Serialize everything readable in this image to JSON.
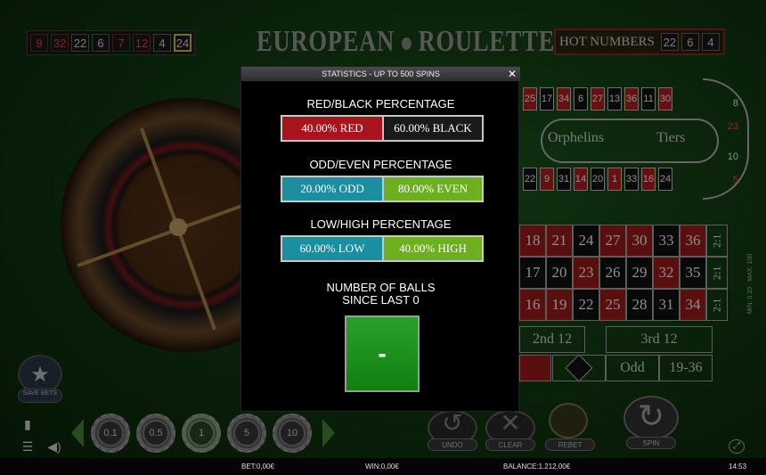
{
  "topbar": {
    "recent_numbers": [
      {
        "n": "9",
        "red": true
      },
      {
        "n": "32",
        "red": true
      },
      {
        "n": "22",
        "red": false
      },
      {
        "n": "6",
        "red": false
      },
      {
        "n": "7",
        "red": true
      },
      {
        "n": "12",
        "red": true
      },
      {
        "n": "4",
        "red": false
      },
      {
        "n": "24",
        "red": false,
        "highlight": true
      }
    ],
    "title_left": "EUROPEAN",
    "title_right": "ROULETTE",
    "hot_label": "HOT NUMBERS",
    "hot_numbers": [
      "22",
      "6",
      "4"
    ]
  },
  "racetrack": {
    "top_row": [
      {
        "n": "25",
        "red": true
      },
      {
        "n": "17",
        "red": false
      },
      {
        "n": "34",
        "red": true
      },
      {
        "n": "6",
        "red": false
      },
      {
        "n": "27",
        "red": true
      },
      {
        "n": "13",
        "red": false
      },
      {
        "n": "36",
        "red": true
      },
      {
        "n": "11",
        "red": false
      },
      {
        "n": "30",
        "red": true
      }
    ],
    "bottom_row": [
      {
        "n": "22",
        "red": false
      },
      {
        "n": "9",
        "red": true
      },
      {
        "n": "31",
        "red": false
      },
      {
        "n": "14",
        "red": true
      },
      {
        "n": "20",
        "red": false
      },
      {
        "n": "1",
        "red": true
      },
      {
        "n": "33",
        "red": false
      },
      {
        "n": "16",
        "red": true
      },
      {
        "n": "24",
        "red": false
      }
    ],
    "end_numbers": [
      {
        "n": "8",
        "red": false
      },
      {
        "n": "23",
        "red": true
      },
      {
        "n": "10",
        "red": false
      },
      {
        "n": "5",
        "red": true
      }
    ],
    "orphelins": "Orphelins",
    "tiers": "Tiers"
  },
  "grid": {
    "rows": [
      [
        {
          "n": "18",
          "red": true
        },
        {
          "n": "21",
          "red": true
        },
        {
          "n": "24",
          "red": false
        },
        {
          "n": "27",
          "red": true
        },
        {
          "n": "30",
          "red": true
        },
        {
          "n": "33",
          "red": false
        },
        {
          "n": "36",
          "red": true
        }
      ],
      [
        {
          "n": "17",
          "red": false
        },
        {
          "n": "20",
          "red": false
        },
        {
          "n": "23",
          "red": true
        },
        {
          "n": "26",
          "red": false
        },
        {
          "n": "29",
          "red": false
        },
        {
          "n": "32",
          "red": true
        },
        {
          "n": "35",
          "red": false
        }
      ],
      [
        {
          "n": "16",
          "red": true
        },
        {
          "n": "19",
          "red": true
        },
        {
          "n": "22",
          "red": false
        },
        {
          "n": "25",
          "red": true
        },
        {
          "n": "28",
          "red": false
        },
        {
          "n": "31",
          "red": false
        },
        {
          "n": "34",
          "red": true
        }
      ]
    ],
    "col_bets": [
      "2:1",
      "2:1",
      "2:1"
    ],
    "dozen_2": "2nd 12",
    "dozen_3": "3rd 12",
    "odd": "Odd",
    "high": "19-36",
    "limits": "MIN: 0.10 · MAX: 100"
  },
  "controls": {
    "chips": [
      "0.1",
      "0.5",
      "1",
      "5",
      "10"
    ],
    "selected_chip": "1",
    "undo": "UNDO",
    "clear": "CLEAR",
    "rebet": "REBET",
    "spin": "SPIN",
    "save_bets": "SAVE BETS"
  },
  "status": {
    "bet": "BET:0,00€",
    "win": "WIN:0,00€",
    "balance": "BALANCE:1.212,00€",
    "time": "14:53"
  },
  "modal": {
    "title": "STATISTICS - UP TO 500 SPINS",
    "close": "✕",
    "sections": [
      {
        "title": "RED/BLACK PERCENTAGE",
        "left": {
          "label": "40.00%  RED",
          "pct": 40,
          "color": "#a8141c"
        },
        "right": {
          "label": "60.00%  BLACK",
          "pct": 60,
          "color": "#1a1a1a"
        }
      },
      {
        "title": "ODD/EVEN PERCENTAGE",
        "left": {
          "label": "20.00%  ODD",
          "pct": 20,
          "color": "#1b8ea0"
        },
        "right": {
          "label": "80.00%  EVEN",
          "pct": 80,
          "color": "#6cb022"
        }
      },
      {
        "title": "LOW/HIGH PERCENTAGE",
        "left": {
          "label": "60.00%  LOW",
          "pct": 60,
          "color": "#1b8ea0"
        },
        "right": {
          "label": "40.00%  HIGH",
          "pct": 40,
          "color": "#6cb022"
        }
      }
    ],
    "balls_title_1": "NUMBER OF BALLS",
    "balls_title_2": "SINCE LAST 0",
    "balls_value": "-"
  },
  "icons": {
    "save": "star-icon",
    "stats": "bar-chart-icon",
    "menu": "menu-icon",
    "sound": "speaker-icon",
    "fullscreen": "expand-icon"
  }
}
